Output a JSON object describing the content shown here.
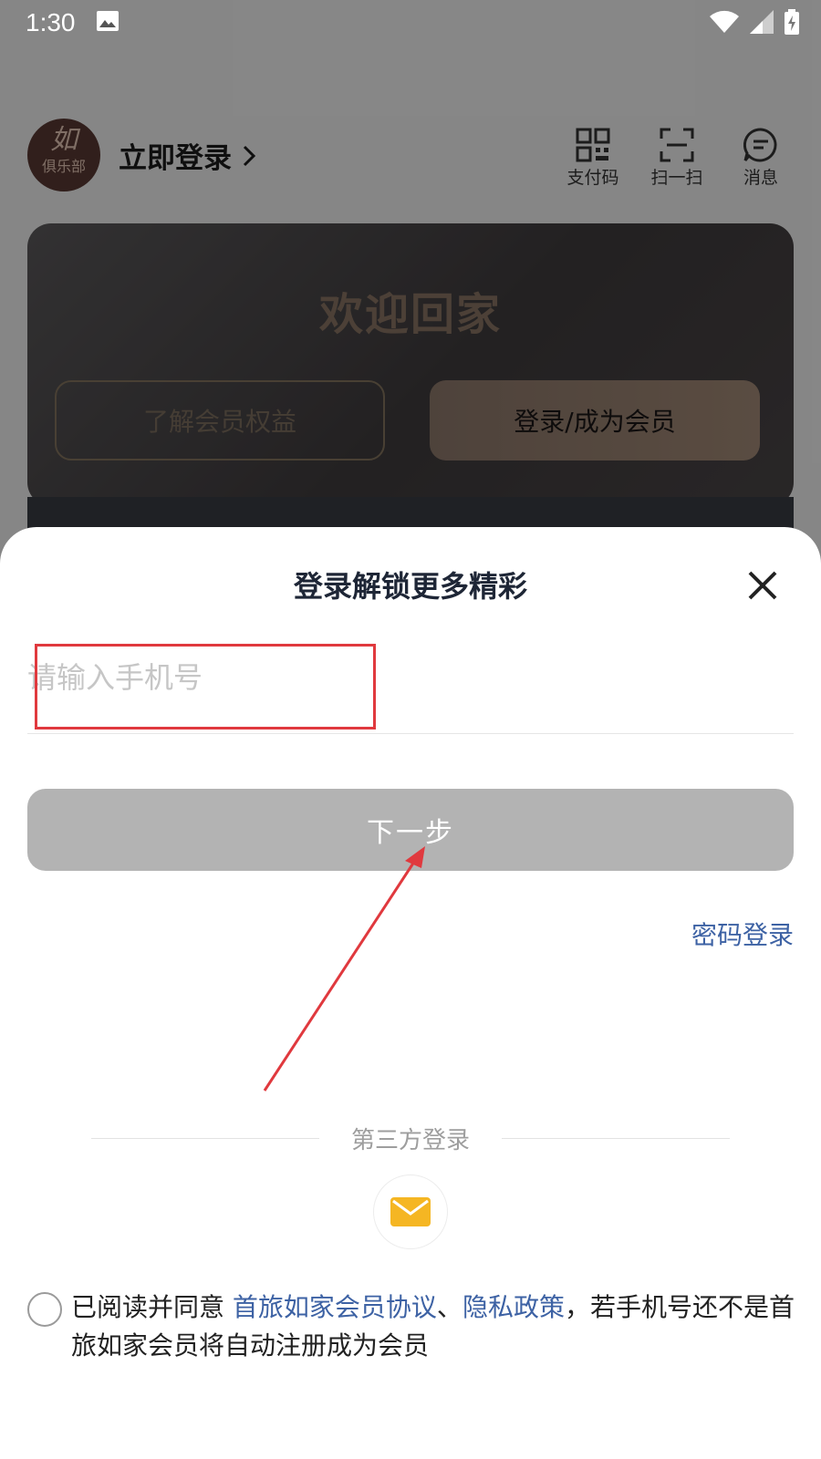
{
  "status_bar": {
    "time": "1:30"
  },
  "header": {
    "avatar_script": "如",
    "avatar_club": "俱乐部",
    "login_now": "立即登录",
    "actions": [
      {
        "label": "支付码",
        "icon": "qr-code-icon"
      },
      {
        "label": "扫一扫",
        "icon": "scan-icon"
      },
      {
        "label": "消息",
        "icon": "message-icon"
      }
    ]
  },
  "member_card": {
    "title": "欢迎回家",
    "learn_benefits": "了解会员权益",
    "login_become_member": "登录/成为会员"
  },
  "sheet": {
    "title": "登录解锁更多精彩",
    "phone_placeholder": "请输入手机号",
    "next_button": "下一步",
    "password_login": "密码登录",
    "third_party_label": "第三方登录",
    "agreement": {
      "prefix": "已阅读并同意 ",
      "member_agreement": "首旅如家会员协议",
      "separator": "、",
      "privacy_policy": "隐私政策",
      "suffix": "，若手机号还不是首旅如家会员将自动注册成为会员"
    }
  },
  "colors": {
    "accent_link": "#3d62a4",
    "annotation_red": "#e0393e",
    "mail_icon": "#f5b623",
    "disabled_button": "#b3b3b3"
  }
}
